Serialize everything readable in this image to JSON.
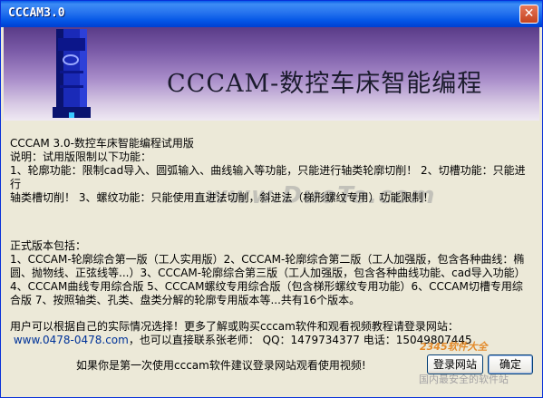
{
  "window": {
    "title": "CCCAM3.0",
    "close_glyph": "✕"
  },
  "banner": {
    "title": "CCCAM-数控车床智能编程"
  },
  "content": {
    "line1": "CCCAM 3.0-数控车床智能编程试用版",
    "line2": "说明：试用版限制以下功能：",
    "line3": "1、轮廓功能：限制cad导入、圆弧输入、曲线输入等功能，只能进行轴类轮廓切削！ 2、切槽功能：只能进行",
    "line4": "轴类槽切削！ 3、螺纹功能：只能使用直进法切削，斜进法（梯形螺纹专用）功能限制！",
    "line5": "正式版本包括：",
    "line6": "1、CCCAM-轮廓综合第一版（工人实用版）2、CCCAM-轮廓综合第二版（工人加强版，包含各种曲线：椭",
    "line7": "圆、抛物线、正弦线等...）3、CCCAM-轮廓综合第三版（工人加强版，包含各种曲线功能、cad导入功能）",
    "line8": "4、CCCAM曲线专用综合版 5、CCCAM螺纹专用综合版（包含梯形螺纹专用功能）6、CCCAM切槽专用综",
    "line9": "合版 7、按照轴类、孔类、盘类分解的轮廓专用版本等...共有16个版本。",
    "line10": "用户可以根据自己的实际情况选择！更多了解或购买cccam软件和观看视频教程请登录网站：",
    "website": "www.0478-0478.com",
    "line11_rest": "，也可以直接联系张老师： QQ：1479734377 电话：15049807445"
  },
  "watermark": "www.DuoTe.com",
  "footer": {
    "prompt": "如果你是第一次使用cccam软件建议登录网站观看使用视频!",
    "login_button": "登录网站",
    "ok_button": "确定"
  },
  "corner_watermark": {
    "logo": "2345软件大全",
    "tagline": "国内最安全的软件站"
  }
}
